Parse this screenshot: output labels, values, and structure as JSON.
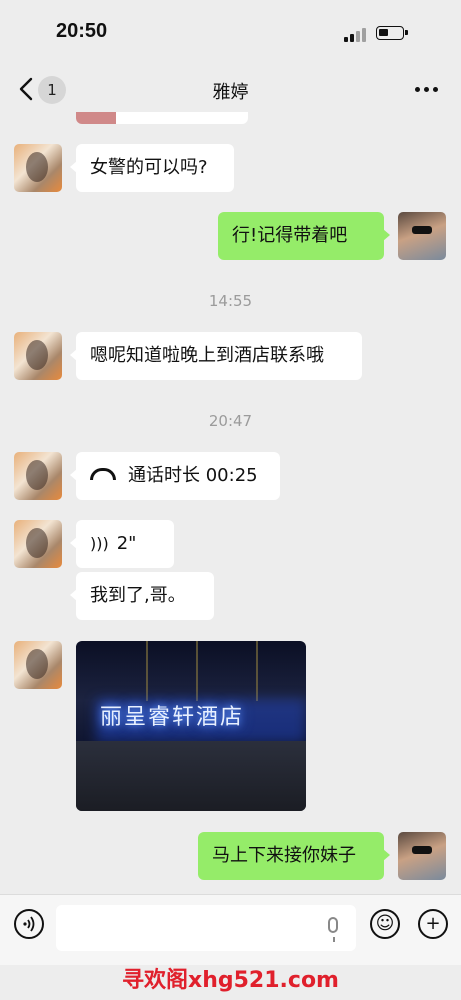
{
  "status_bar": {
    "time": "20:50"
  },
  "nav": {
    "unread_count": "1",
    "title": "雅婷"
  },
  "messages": [
    {
      "text": "女警的可以吗?"
    },
    {
      "text": "行!记得带着吧"
    },
    {
      "text": "嗯呢知道啦晚上到酒店联系哦"
    },
    {
      "text": "通话时长 00:25"
    },
    {
      "text": "2\""
    },
    {
      "text": "我到了,哥。"
    },
    {
      "text": "丽呈睿轩酒店"
    },
    {
      "text": "马上下来接你妹子"
    }
  ],
  "timestamps": [
    "14:55",
    "20:47"
  ],
  "input_bar": {
    "placeholder": "",
    "emoji_icon": "☺",
    "plus_icon": "+"
  },
  "watermark": "寻欢阁xhg521.com",
  "colors": {
    "outgoing_bubble": "#95ec69",
    "incoming_bubble": "#ffffff",
    "background": "#ededed",
    "watermark": "#e0202c"
  }
}
